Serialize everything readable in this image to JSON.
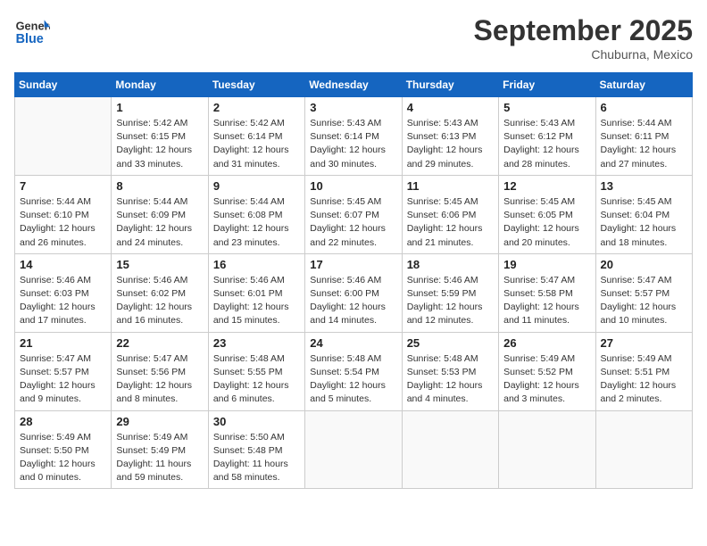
{
  "header": {
    "logo_line1": "General",
    "logo_line2": "Blue",
    "month": "September 2025",
    "location": "Chuburna, Mexico"
  },
  "weekdays": [
    "Sunday",
    "Monday",
    "Tuesday",
    "Wednesday",
    "Thursday",
    "Friday",
    "Saturday"
  ],
  "weeks": [
    [
      {
        "day": "",
        "info": ""
      },
      {
        "day": "1",
        "info": "Sunrise: 5:42 AM\nSunset: 6:15 PM\nDaylight: 12 hours\nand 33 minutes."
      },
      {
        "day": "2",
        "info": "Sunrise: 5:42 AM\nSunset: 6:14 PM\nDaylight: 12 hours\nand 31 minutes."
      },
      {
        "day": "3",
        "info": "Sunrise: 5:43 AM\nSunset: 6:14 PM\nDaylight: 12 hours\nand 30 minutes."
      },
      {
        "day": "4",
        "info": "Sunrise: 5:43 AM\nSunset: 6:13 PM\nDaylight: 12 hours\nand 29 minutes."
      },
      {
        "day": "5",
        "info": "Sunrise: 5:43 AM\nSunset: 6:12 PM\nDaylight: 12 hours\nand 28 minutes."
      },
      {
        "day": "6",
        "info": "Sunrise: 5:44 AM\nSunset: 6:11 PM\nDaylight: 12 hours\nand 27 minutes."
      }
    ],
    [
      {
        "day": "7",
        "info": "Sunrise: 5:44 AM\nSunset: 6:10 PM\nDaylight: 12 hours\nand 26 minutes."
      },
      {
        "day": "8",
        "info": "Sunrise: 5:44 AM\nSunset: 6:09 PM\nDaylight: 12 hours\nand 24 minutes."
      },
      {
        "day": "9",
        "info": "Sunrise: 5:44 AM\nSunset: 6:08 PM\nDaylight: 12 hours\nand 23 minutes."
      },
      {
        "day": "10",
        "info": "Sunrise: 5:45 AM\nSunset: 6:07 PM\nDaylight: 12 hours\nand 22 minutes."
      },
      {
        "day": "11",
        "info": "Sunrise: 5:45 AM\nSunset: 6:06 PM\nDaylight: 12 hours\nand 21 minutes."
      },
      {
        "day": "12",
        "info": "Sunrise: 5:45 AM\nSunset: 6:05 PM\nDaylight: 12 hours\nand 20 minutes."
      },
      {
        "day": "13",
        "info": "Sunrise: 5:45 AM\nSunset: 6:04 PM\nDaylight: 12 hours\nand 18 minutes."
      }
    ],
    [
      {
        "day": "14",
        "info": "Sunrise: 5:46 AM\nSunset: 6:03 PM\nDaylight: 12 hours\nand 17 minutes."
      },
      {
        "day": "15",
        "info": "Sunrise: 5:46 AM\nSunset: 6:02 PM\nDaylight: 12 hours\nand 16 minutes."
      },
      {
        "day": "16",
        "info": "Sunrise: 5:46 AM\nSunset: 6:01 PM\nDaylight: 12 hours\nand 15 minutes."
      },
      {
        "day": "17",
        "info": "Sunrise: 5:46 AM\nSunset: 6:00 PM\nDaylight: 12 hours\nand 14 minutes."
      },
      {
        "day": "18",
        "info": "Sunrise: 5:46 AM\nSunset: 5:59 PM\nDaylight: 12 hours\nand 12 minutes."
      },
      {
        "day": "19",
        "info": "Sunrise: 5:47 AM\nSunset: 5:58 PM\nDaylight: 12 hours\nand 11 minutes."
      },
      {
        "day": "20",
        "info": "Sunrise: 5:47 AM\nSunset: 5:57 PM\nDaylight: 12 hours\nand 10 minutes."
      }
    ],
    [
      {
        "day": "21",
        "info": "Sunrise: 5:47 AM\nSunset: 5:57 PM\nDaylight: 12 hours\nand 9 minutes."
      },
      {
        "day": "22",
        "info": "Sunrise: 5:47 AM\nSunset: 5:56 PM\nDaylight: 12 hours\nand 8 minutes."
      },
      {
        "day": "23",
        "info": "Sunrise: 5:48 AM\nSunset: 5:55 PM\nDaylight: 12 hours\nand 6 minutes."
      },
      {
        "day": "24",
        "info": "Sunrise: 5:48 AM\nSunset: 5:54 PM\nDaylight: 12 hours\nand 5 minutes."
      },
      {
        "day": "25",
        "info": "Sunrise: 5:48 AM\nSunset: 5:53 PM\nDaylight: 12 hours\nand 4 minutes."
      },
      {
        "day": "26",
        "info": "Sunrise: 5:49 AM\nSunset: 5:52 PM\nDaylight: 12 hours\nand 3 minutes."
      },
      {
        "day": "27",
        "info": "Sunrise: 5:49 AM\nSunset: 5:51 PM\nDaylight: 12 hours\nand 2 minutes."
      }
    ],
    [
      {
        "day": "28",
        "info": "Sunrise: 5:49 AM\nSunset: 5:50 PM\nDaylight: 12 hours\nand 0 minutes."
      },
      {
        "day": "29",
        "info": "Sunrise: 5:49 AM\nSunset: 5:49 PM\nDaylight: 11 hours\nand 59 minutes."
      },
      {
        "day": "30",
        "info": "Sunrise: 5:50 AM\nSunset: 5:48 PM\nDaylight: 11 hours\nand 58 minutes."
      },
      {
        "day": "",
        "info": ""
      },
      {
        "day": "",
        "info": ""
      },
      {
        "day": "",
        "info": ""
      },
      {
        "day": "",
        "info": ""
      }
    ]
  ]
}
